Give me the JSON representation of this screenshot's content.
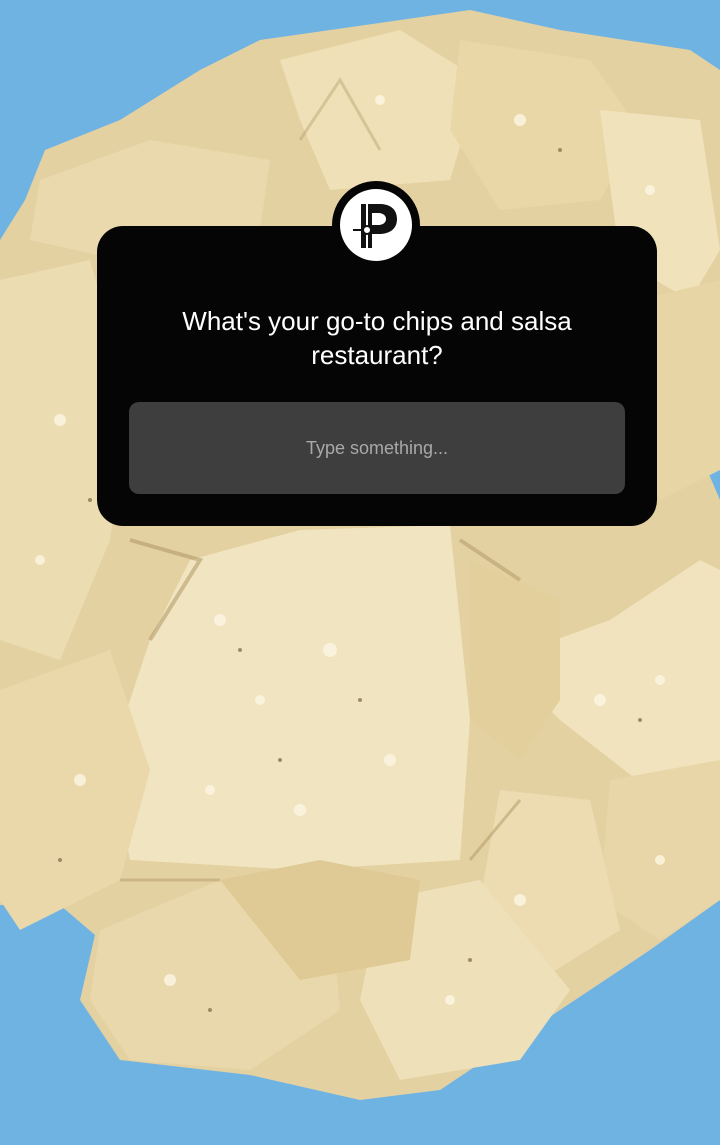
{
  "story": {
    "background_color": "#6fb3e3",
    "photo_subject": "tortilla-chips"
  },
  "question_sticker": {
    "avatar_icon": "p-logo-icon",
    "question": "What's your go-to chips and salsa restaurant?",
    "answer_placeholder": "Type something..."
  }
}
